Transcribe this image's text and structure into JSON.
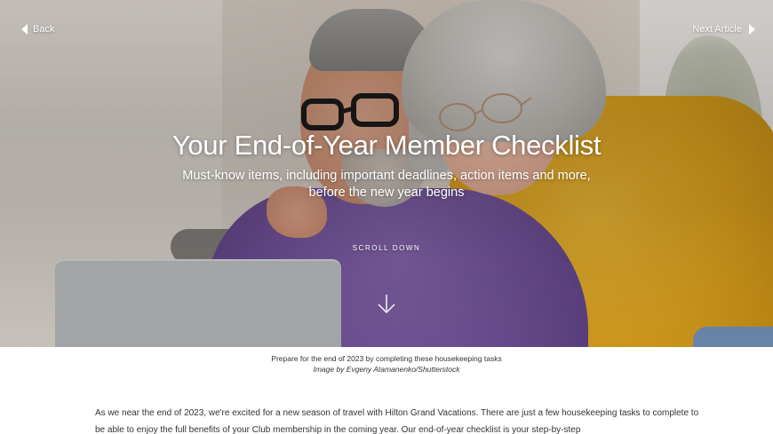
{
  "nav": {
    "back_label": "Back",
    "next_label": "Next Article",
    "back_icon": "chevron-left-icon",
    "next_icon": "chevron-right-icon"
  },
  "hero": {
    "title": "Your End-of-Year Member Checklist",
    "subtitle": "Must-know items, including important deadlines, action items and more, before the new year begins",
    "scroll_label": "SCROLL DOWN",
    "scroll_icon": "arrow-down-icon"
  },
  "caption": {
    "text": "Prepare for the end of 2023 by completing these housekeeping tasks",
    "credit": "Image by Evgeny Atamanenko/Shutterstock"
  },
  "article": {
    "paragraph": "As we near the end of 2023, we're excited for a new season of travel with Hilton Grand Vacations. There are just a few housekeeping tasks to complete to be able to enjoy the full benefits of your Club membership in the coming year. Our end-of-year checklist is your step-by-step"
  },
  "colors": {
    "text_primary": "#333333",
    "overlay_text": "#ffffff",
    "sweater_purple": "#6d4f94",
    "sweater_yellow": "#d79e1d"
  }
}
